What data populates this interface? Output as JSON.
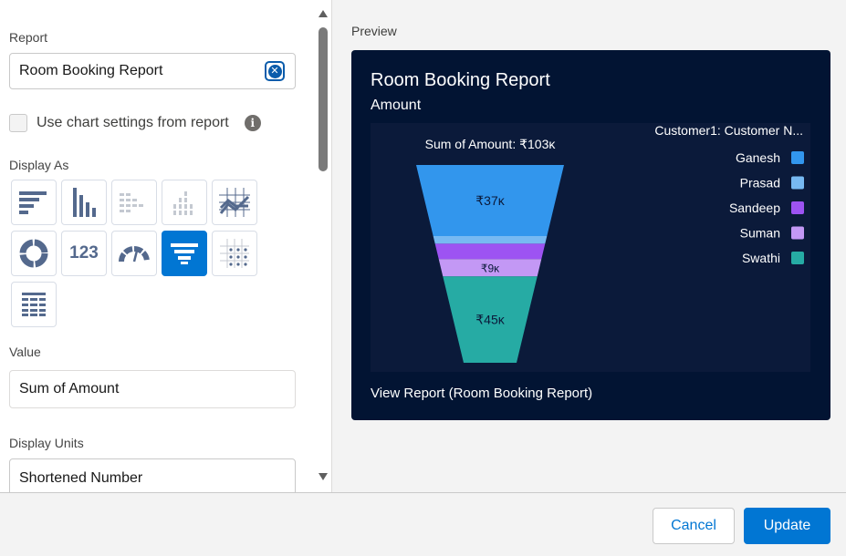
{
  "report_field": {
    "label": "Report",
    "value": "Room Booking Report"
  },
  "use_chart_settings": {
    "label": "Use chart settings from report",
    "checked": false
  },
  "display_as": {
    "label": "Display As",
    "options": [
      {
        "name": "horizontal-bar",
        "selected": false
      },
      {
        "name": "vertical-bar",
        "selected": false
      },
      {
        "name": "stacked-horizontal-bar",
        "selected": false
      },
      {
        "name": "stacked-vertical-bar",
        "selected": false
      },
      {
        "name": "line",
        "selected": false
      },
      {
        "name": "donut",
        "selected": false
      },
      {
        "name": "metric",
        "selected": false
      },
      {
        "name": "gauge",
        "selected": false
      },
      {
        "name": "funnel",
        "selected": true
      },
      {
        "name": "scatter",
        "selected": false
      },
      {
        "name": "table",
        "selected": false
      }
    ],
    "metric_label": "123"
  },
  "value_field": {
    "label": "Value",
    "value": "Sum of Amount"
  },
  "display_units": {
    "label": "Display Units",
    "value": "Shortened Number"
  },
  "preview": {
    "label": "Preview",
    "title": "Room Booking Report",
    "subtitle": "Amount",
    "view_link": "View Report (Room Booking Report)"
  },
  "chart_data": {
    "type": "funnel",
    "title": "Sum of Amount: ₹103ĸ",
    "legend_title": "Customer1: Customer N...",
    "legend_position": "top-right",
    "currency": "₹",
    "series": [
      {
        "name": "Ganesh",
        "value": 37,
        "label": "₹37ĸ",
        "color": "#3296ed"
      },
      {
        "name": "Prasad",
        "value": 4,
        "label": "",
        "color": "#77b9f2"
      },
      {
        "name": "Sandeep",
        "value": 8,
        "label": "",
        "color": "#9d53f2"
      },
      {
        "name": "Suman",
        "value": 9,
        "label": "₹9ĸ",
        "color": "#c398f5"
      },
      {
        "name": "Swathi",
        "value": 45,
        "label": "₹45ĸ",
        "color": "#26aba4"
      }
    ]
  },
  "footer": {
    "cancel_label": "Cancel",
    "update_label": "Update"
  },
  "colors": {
    "brand": "#0176d3",
    "card_bg": "#021433",
    "plot_bg": "#0b1a3a"
  }
}
